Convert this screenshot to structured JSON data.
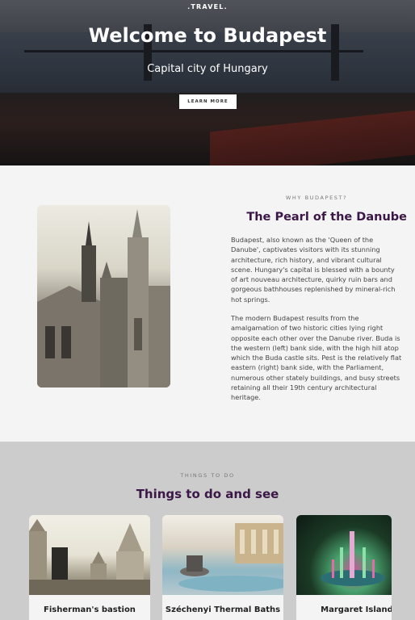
{
  "hero": {
    "brand": ".TRAVEL.",
    "title": "Welcome to Budapest",
    "subtitle": "Capital city of Hungary",
    "cta_label": "LEARN MORE"
  },
  "about": {
    "eyebrow": "WHY BUDAPEST?",
    "heading": "The Pearl of the Danube",
    "paragraph1": "Budapest, also known as the 'Queen of the Danube', captivates visitors with its stunning architecture, rich history, and vibrant cultural scene. Hungary's capital is blessed with a bounty of art nouveau architecture, quirky ruin bars and gorgeous bathhouses replenished by mineral-rich hot springs.",
    "paragraph2": "The modern Budapest results from the amalgamation of two historic cities lying right opposite each other over the Danube river. Buda is the western (left) bank side, with the high hill atop which the Buda castle sits. Pest is the relatively flat eastern (right) bank side, with the Parliament, numerous other stately buildings, and busy streets retaining all their 19th century architectural heritage."
  },
  "things": {
    "eyebrow": "THINGS TO DO",
    "heading": "Things to do and see",
    "cards": [
      {
        "label": "Fisherman's bastion"
      },
      {
        "label": "Széchenyi Thermal Baths"
      },
      {
        "label": "Margaret Island"
      }
    ]
  },
  "colors": {
    "heading_purple": "#3b1747",
    "section_gray": "#cccccc",
    "section_light": "#f4f4f4"
  }
}
